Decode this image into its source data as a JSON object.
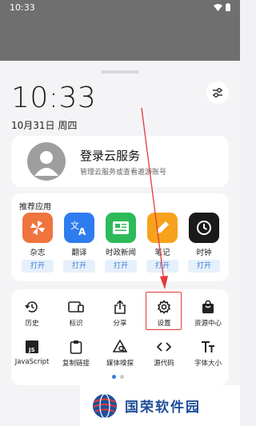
{
  "status_bar": {
    "time": "10:33"
  },
  "header": {
    "clock": "10:33",
    "date": "10月31日 周四"
  },
  "login": {
    "title": "登录云服务",
    "subtitle": "管理云服务或查看邀游账号"
  },
  "recommended": {
    "title": "推荐应用",
    "apps": [
      {
        "label": "杂志",
        "open": "打开",
        "icon": "magazine-icon",
        "color": "#f0743e"
      },
      {
        "label": "翻译",
        "open": "打开",
        "icon": "translate-icon",
        "color": "#2f7cf0"
      },
      {
        "label": "时政新闻",
        "open": "打开",
        "icon": "news-icon",
        "color": "#2dbb5a"
      },
      {
        "label": "笔记",
        "open": "打开",
        "icon": "notes-icon",
        "color": "#f7a21c"
      },
      {
        "label": "时钟",
        "open": "打开",
        "icon": "clock-icon",
        "color": "#1a1a1a"
      }
    ]
  },
  "tools": [
    {
      "label": "历史",
      "icon": "history-icon"
    },
    {
      "label": "标识",
      "icon": "marker-icon"
    },
    {
      "label": "分享",
      "icon": "share-icon"
    },
    {
      "label": "设置",
      "icon": "gear-icon"
    },
    {
      "label": "资源中心",
      "icon": "bag-icon"
    },
    {
      "label": "JavaScript",
      "icon": "js-icon"
    },
    {
      "label": "复制链接",
      "icon": "clipboard-icon"
    },
    {
      "label": "媒体嗅探",
      "icon": "media-sniff-icon"
    },
    {
      "label": "源代码",
      "icon": "code-icon"
    },
    {
      "label": "字体大小",
      "icon": "font-size-icon"
    }
  ],
  "pager": {
    "active_color": "#3a7bd5",
    "inactive_color": "#c9c9cf"
  },
  "watermark": {
    "text": "国荣软件园"
  },
  "colors": {
    "highlight": "#e23b3b",
    "accent": "#3a7bd5"
  }
}
